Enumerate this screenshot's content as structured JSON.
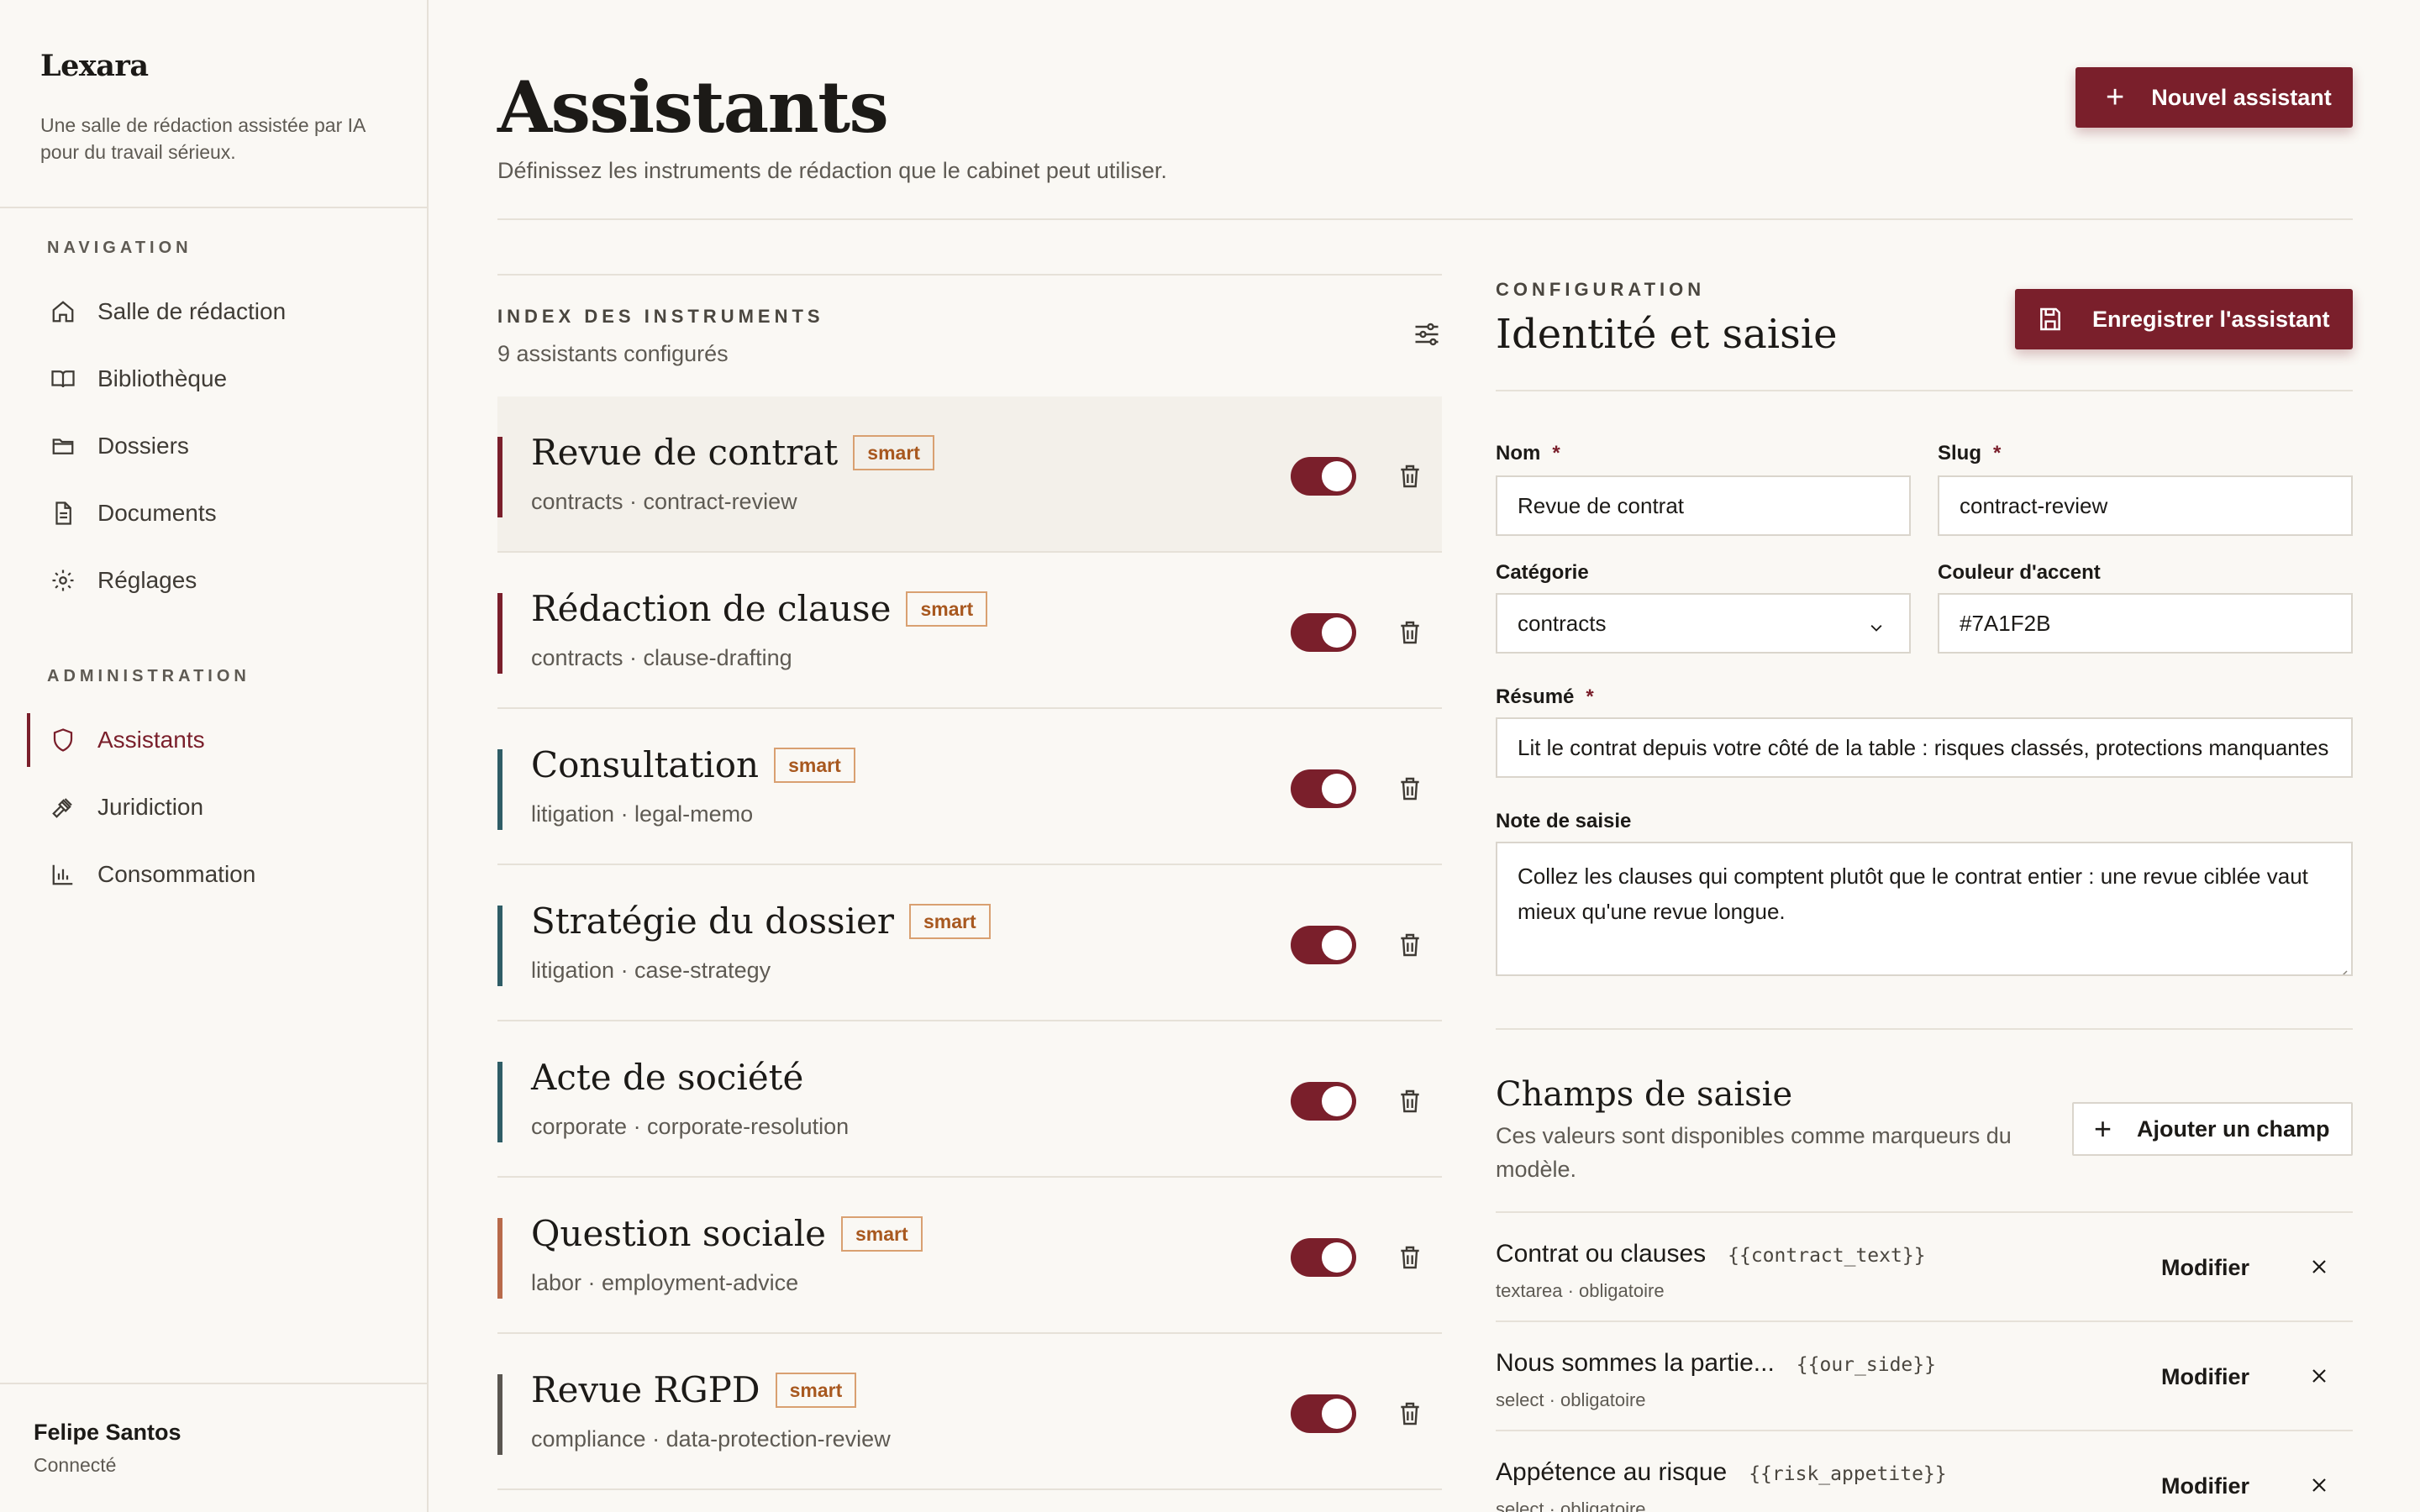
{
  "brand": {
    "name": "Lexara",
    "tagline": "Une salle de rédaction assistée par IA pour du travail sérieux."
  },
  "nav": {
    "section_label": "NAVIGATION",
    "items": [
      {
        "label": "Salle de rédaction",
        "icon": "home-icon"
      },
      {
        "label": "Bibliothèque",
        "icon": "book-icon"
      },
      {
        "label": "Dossiers",
        "icon": "folder-icon"
      },
      {
        "label": "Documents",
        "icon": "document-icon"
      },
      {
        "label": "Réglages",
        "icon": "gear-icon"
      }
    ]
  },
  "admin": {
    "section_label": "ADMINISTRATION",
    "items": [
      {
        "label": "Assistants",
        "icon": "shield-icon",
        "active": true
      },
      {
        "label": "Juridiction",
        "icon": "gavel-icon"
      },
      {
        "label": "Consommation",
        "icon": "bar-chart-icon"
      }
    ]
  },
  "user": {
    "name": "Felipe Santos",
    "status": "Connecté"
  },
  "header": {
    "title": "Assistants",
    "subtitle": "Définissez les instruments de rédaction que le cabinet peut utiliser.",
    "new_button": "Nouvel assistant"
  },
  "index": {
    "label": "INDEX DES INSTRUMENTS",
    "count": "9 assistants configurés",
    "items": [
      {
        "title": "Revue de contrat",
        "badge": "smart",
        "meta": "contracts · contract-review",
        "accent": "#7A1F2B",
        "enabled": true,
        "selected": true
      },
      {
        "title": "Rédaction de clause",
        "badge": "smart",
        "meta": "contracts · clause-drafting",
        "accent": "#7A1F2B",
        "enabled": true
      },
      {
        "title": "Consultation",
        "badge": "smart",
        "meta": "litigation · legal-memo",
        "accent": "#2F5D66",
        "enabled": true
      },
      {
        "title": "Stratégie du dossier",
        "badge": "smart",
        "meta": "litigation · case-strategy",
        "accent": "#2F5D66",
        "enabled": true
      },
      {
        "title": "Acte de société",
        "badge": "",
        "meta": "corporate · corporate-resolution",
        "accent": "#2F5D66",
        "enabled": true
      },
      {
        "title": "Question sociale",
        "badge": "smart",
        "meta": "labor · employment-advice",
        "accent": "#B86A4A",
        "enabled": true
      },
      {
        "title": "Revue RGPD",
        "badge": "smart",
        "meta": "compliance · data-protection-review",
        "accent": "#5A5650",
        "enabled": true
      }
    ]
  },
  "config": {
    "section_label": "CONFIGURATION",
    "title": "Identité et saisie",
    "save_button": "Enregistrer l'assistant",
    "required_mark": "*",
    "fields": {
      "nom": {
        "label": "Nom",
        "value": "Revue de contrat"
      },
      "slug": {
        "label": "Slug",
        "value": "contract-review"
      },
      "categorie": {
        "label": "Catégorie",
        "value": "contracts"
      },
      "couleur": {
        "label": "Couleur d'accent",
        "value": "#7A1F2B"
      },
      "resume": {
        "label": "Résumé",
        "value": "Lit le contrat depuis votre côté de la table : risques classés, protections manquantes"
      },
      "note": {
        "label": "Note de saisie",
        "value": "Collez les clauses qui comptent plutôt que le contrat entier : une revue ciblée vaut mieux qu'une revue longue."
      }
    }
  },
  "champs": {
    "title": "Champs de saisie",
    "subtitle": "Ces valeurs sont disponibles comme marqueurs du modèle.",
    "add_button": "Ajouter un champ",
    "edit_label": "Modifier",
    "items": [
      {
        "name": "Contrat ou clauses",
        "token": "{{contract_text}}",
        "meta": "textarea · obligatoire"
      },
      {
        "name": "Nous sommes la partie...",
        "token": "{{our_side}}",
        "meta": "select · obligatoire"
      },
      {
        "name": "Appétence au risque",
        "token": "{{risk_appetite}}",
        "meta": "select · obligatoire"
      }
    ]
  },
  "colors": {
    "accent": "#7A1F2B",
    "background": "#FAF8F4",
    "badge": "#A8581F"
  }
}
